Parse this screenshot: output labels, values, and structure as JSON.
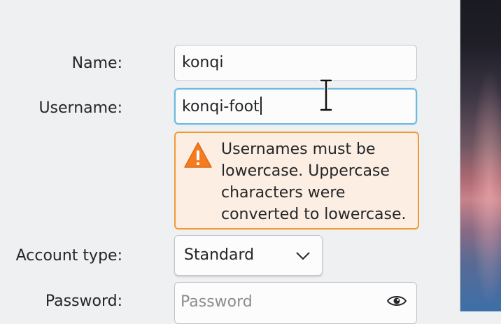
{
  "form": {
    "name": {
      "label": "Name:",
      "value": "konqi"
    },
    "username": {
      "label": "Username:",
      "value": "konqi-foot"
    },
    "warning": {
      "icon": "warning-triangle-icon",
      "message": "Usernames must be lowercase. Uppercase characters were converted to lowercase.",
      "color": "#f29b35",
      "background": "#fdeee3"
    },
    "account_type": {
      "label": "Account type:",
      "selected": "Standard",
      "icon": "chevron-down-icon"
    },
    "password": {
      "label": "Password:",
      "value": "",
      "placeholder": "Password",
      "icon": "eye-icon"
    }
  },
  "colors": {
    "focus": "#6fb8df",
    "window_bg": "#eff0f1",
    "field_bg": "#fcfcfc"
  }
}
